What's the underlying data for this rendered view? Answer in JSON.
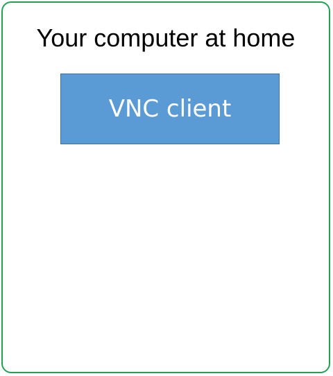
{
  "container": {
    "title": "Your computer at home",
    "border_color": "#22a155"
  },
  "client_box": {
    "label": "VNC client",
    "fill_color": "#5b9bd5",
    "border_color": "#41719c"
  }
}
